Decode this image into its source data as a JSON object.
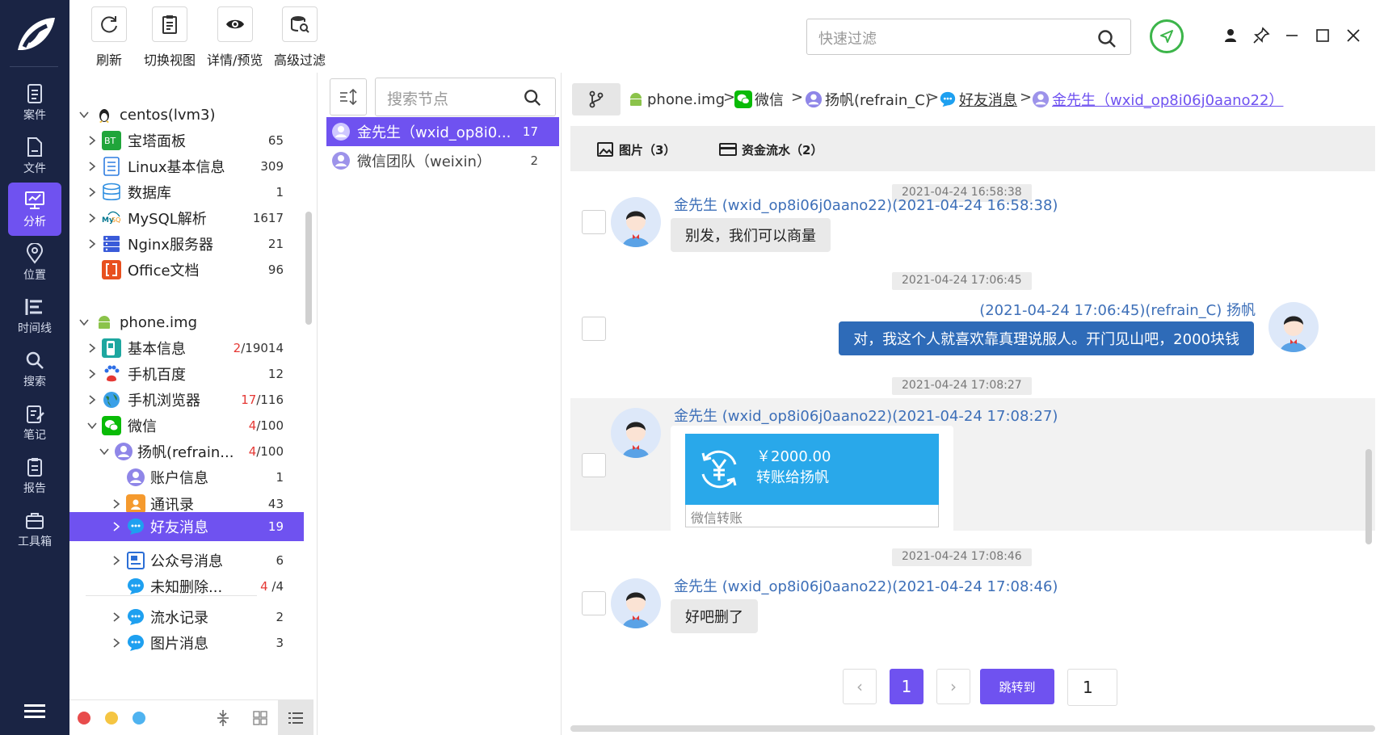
{
  "rail": {
    "items": [
      {
        "label": "案件",
        "icon": "case-icon"
      },
      {
        "label": "文件",
        "icon": "file-icon"
      },
      {
        "label": "分析",
        "icon": "analysis-icon",
        "active": true
      },
      {
        "label": "位置",
        "icon": "location-icon"
      },
      {
        "label": "时间线",
        "icon": "timeline-icon"
      },
      {
        "label": "搜索",
        "icon": "search-icon"
      },
      {
        "label": "笔记",
        "icon": "note-icon"
      },
      {
        "label": "报告",
        "icon": "report-icon"
      },
      {
        "label": "工具箱",
        "icon": "toolbox-icon"
      }
    ]
  },
  "toolbar": {
    "refresh": "刷新",
    "switch_view": "切换视图",
    "detail_preview": "详情/预览",
    "advanced_filter": "高级过滤",
    "quick_filter_placeholder": "快速过滤"
  },
  "tree": {
    "centos": "centos(lvm3)",
    "bt": {
      "label": "宝塔面板",
      "count": "65"
    },
    "linux": {
      "label": "Linux基本信息",
      "count": "309"
    },
    "db": {
      "label": "数据库",
      "count": "1"
    },
    "mysql": {
      "label": "MySQL解析",
      "count": "1617"
    },
    "nginx": {
      "label": "Nginx服务器",
      "count": "21"
    },
    "office": {
      "label": "Office文档",
      "count": "96"
    },
    "phone": "phone.img",
    "basic": {
      "label": "基本信息",
      "red": "2",
      "count": "/19014"
    },
    "baidu": {
      "label": "手机百度",
      "count": "12"
    },
    "browser": {
      "label": "手机浏览器",
      "red": "17",
      "count": "/116"
    },
    "wechat": {
      "label": "微信",
      "red": "4",
      "count": "/100"
    },
    "yangfan": {
      "label": "扬帆(refrain...",
      "red": "4",
      "count": "/100"
    },
    "account": {
      "label": "账户信息",
      "count": "1"
    },
    "contacts": {
      "label": "通讯录",
      "count": "43"
    },
    "friends": {
      "label": "好友消息",
      "count": "19"
    },
    "official": {
      "label": "公众号消息",
      "count": "6"
    },
    "unknown": {
      "label": "未知删除...",
      "red": "4",
      "count": "/4"
    },
    "flow": {
      "label": "流水记录",
      "count": "2"
    },
    "images": {
      "label": "图片消息",
      "count": "3"
    }
  },
  "status_colors": {
    "red": "#e84c4c",
    "yellow": "#f5c542",
    "blue": "#4fb3f0"
  },
  "node_search_placeholder": "搜索节点",
  "contacts": [
    {
      "name": "金先生（wxid_op8i0...",
      "count": "17"
    },
    {
      "name": "微信团队（weixin）",
      "count": "2"
    }
  ],
  "breadcrumb": {
    "c1": "phone.img",
    "c2": "微信",
    "c3": "扬帆(refrain_C)",
    "c4": "好友消息",
    "c5": "金先生（wxid_op8i06j0aano22）",
    "sep": ">"
  },
  "tabs": {
    "images": "图片（3）",
    "funds": "资金流水（2）"
  },
  "messages": [
    {
      "time": "2021-04-24 16:58:38",
      "sender": "金先生 (wxid_op8i06j0aano22)(2021-04-24 16:58:38)",
      "text": "别发，我们可以商量"
    },
    {
      "time": "2021-04-24 17:06:45",
      "sender": "(2021-04-24 17:06:45)(refrain_C) 扬帆",
      "text": "对，我这个人就喜欢靠真理说服人。开门见山吧，2000块钱"
    },
    {
      "time": "2021-04-24 17:08:27",
      "sender": "金先生 (wxid_op8i06j0aano22)(2021-04-24 17:08:27)",
      "amount": "￥2000.00",
      "to": "转账给扬帆",
      "footer": "微信转账"
    },
    {
      "time": "2021-04-24 17:08:46",
      "sender": "金先生 (wxid_op8i06j0aano22)(2021-04-24 17:08:46)",
      "text": "好吧删了"
    }
  ],
  "pager": {
    "prev": "‹",
    "current": "1",
    "next": "›",
    "jump": "跳转到",
    "input": "1"
  },
  "accent": "#6f52f0"
}
